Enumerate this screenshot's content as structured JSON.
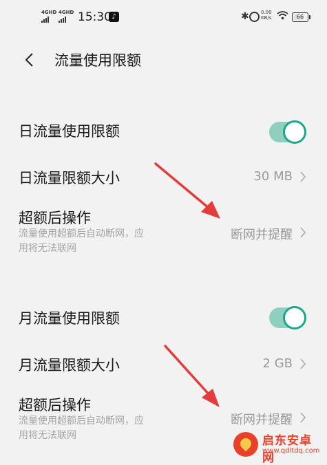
{
  "status_bar": {
    "signal1": "4GHD",
    "signal2": "4GHD",
    "time": "15:30",
    "net_speed_value": "0.00",
    "net_speed_unit": "KB/s",
    "battery": "66"
  },
  "header": {
    "title": "流量使用限额"
  },
  "daily": {
    "limit_label": "日流量使用限额",
    "limit_enabled": true,
    "size_label": "日流量限额大小",
    "size_value": "30 MB",
    "action_label": "超额后操作",
    "action_desc": "流量使用超额后自动断网，应用将无法联网",
    "action_value": "断网并提醒"
  },
  "monthly": {
    "limit_label": "月流量使用限额",
    "limit_enabled": true,
    "size_label": "月流量限额大小",
    "size_value": "2 GB",
    "action_label": "超额后操作",
    "action_desc": "流量使用超额后自动断网，应用将无法联网",
    "action_value": "断网并提醒"
  },
  "watermark": {
    "name": "启东安卓网",
    "url": "www.qdltdq.com"
  },
  "colors": {
    "accent": "#1aa88a",
    "toggle_track": "#8fcfc0",
    "arrow": "#e53b3b",
    "secondary_text": "#9a9a9a"
  }
}
